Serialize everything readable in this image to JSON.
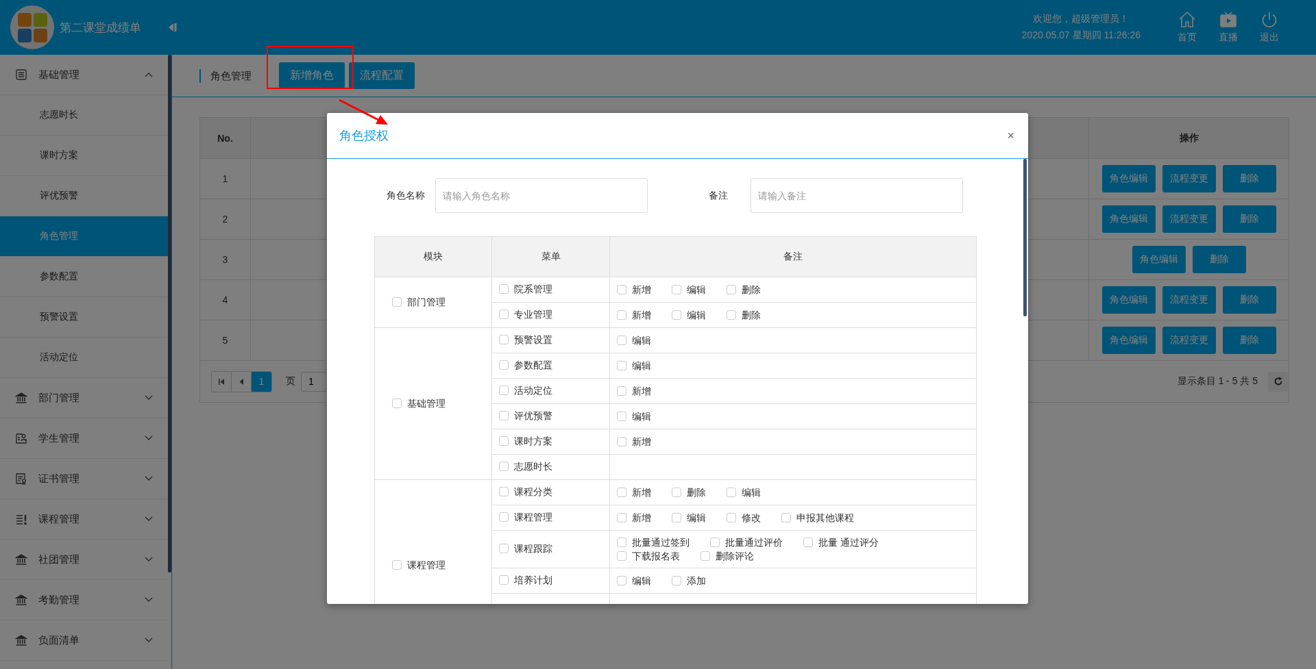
{
  "header": {
    "title": "第二课堂成绩单",
    "welcome": "欢迎您，超级管理员！",
    "datetime": "2020.05.07 星期四 11:26:26",
    "nav": [
      {
        "label": "首页"
      },
      {
        "label": "直播"
      },
      {
        "label": "退出"
      }
    ]
  },
  "sidebar": {
    "groups": [
      {
        "label": "基础管理",
        "expanded": true,
        "children": [
          {
            "label": "志愿时长",
            "selected": false
          },
          {
            "label": "课时方案",
            "selected": false
          },
          {
            "label": "评优预警",
            "selected": false
          },
          {
            "label": "角色管理",
            "selected": true
          },
          {
            "label": "参数配置",
            "selected": false
          },
          {
            "label": "预警设置",
            "selected": false
          },
          {
            "label": "活动定位",
            "selected": false
          }
        ]
      },
      {
        "label": "部门管理",
        "expanded": false
      },
      {
        "label": "学生管理",
        "expanded": false
      },
      {
        "label": "证书管理",
        "expanded": false
      },
      {
        "label": "课程管理",
        "expanded": false
      },
      {
        "label": "社团管理",
        "expanded": false
      },
      {
        "label": "考勤管理",
        "expanded": false
      },
      {
        "label": "负面清单",
        "expanded": false
      }
    ]
  },
  "toolbar": {
    "breadcrumb": "角色管理",
    "buttons": [
      "新增角色",
      "流程配置"
    ]
  },
  "table": {
    "columns": [
      "No.",
      "操作"
    ],
    "rows": [
      {
        "no": "1",
        "actions": [
          "角色编辑",
          "流程变更",
          "删除"
        ]
      },
      {
        "no": "2",
        "actions": [
          "角色编辑",
          "流程变更",
          "删除"
        ]
      },
      {
        "no": "3",
        "actions": [
          "角色编辑",
          "删除"
        ]
      },
      {
        "no": "4",
        "actions": [
          "角色编辑",
          "流程变更",
          "删除"
        ]
      },
      {
        "no": "5",
        "actions": [
          "角色编辑",
          "流程变更",
          "删除"
        ]
      }
    ],
    "pagination": {
      "current": "1",
      "page_label": "页",
      "page_input": "1",
      "summary": "显示条目 1 - 5 共 5"
    }
  },
  "dialog": {
    "title": "角色授权",
    "close": "×",
    "fields": [
      {
        "label": "角色名称",
        "placeholder": "请输入角色名称"
      },
      {
        "label": "备注",
        "placeholder": "请输入备注"
      }
    ],
    "columns": [
      "模块",
      "菜单",
      "备注"
    ],
    "modules": [
      {
        "name": "部门管理",
        "checked": false,
        "menus": [
          {
            "name": "院系管理",
            "checked": false,
            "actions": [
              {
                "label": "新增",
                "checked": false
              },
              {
                "label": "编辑",
                "checked": false
              },
              {
                "label": "删除",
                "checked": false
              }
            ]
          },
          {
            "name": "专业管理",
            "checked": false,
            "actions": [
              {
                "label": "新增",
                "checked": false
              },
              {
                "label": "编辑",
                "checked": false
              },
              {
                "label": "删除",
                "checked": false
              }
            ]
          }
        ]
      },
      {
        "name": "基础管理",
        "checked": false,
        "menus": [
          {
            "name": "预警设置",
            "checked": false,
            "actions": [
              {
                "label": "编辑",
                "checked": false
              }
            ]
          },
          {
            "name": "参数配置",
            "checked": false,
            "actions": [
              {
                "label": "编辑",
                "checked": false
              }
            ]
          },
          {
            "name": "活动定位",
            "checked": false,
            "actions": [
              {
                "label": "新增",
                "checked": false
              }
            ]
          },
          {
            "name": "评优预警",
            "checked": false,
            "actions": [
              {
                "label": "编辑",
                "checked": false
              }
            ]
          },
          {
            "name": "课时方案",
            "checked": false,
            "actions": [
              {
                "label": "新增",
                "checked": false
              }
            ]
          },
          {
            "name": "志愿时长",
            "checked": false
          }
        ]
      },
      {
        "name": "课程管理",
        "checked": false,
        "menus": [
          {
            "name": "课程分类",
            "checked": false,
            "actions": [
              {
                "label": "新增",
                "checked": false
              },
              {
                "label": "删除",
                "checked": false
              },
              {
                "label": "编辑",
                "checked": false
              }
            ]
          },
          {
            "name": "课程管理",
            "checked": false,
            "actions": [
              {
                "label": "新增",
                "checked": false
              },
              {
                "label": "编辑",
                "checked": false
              },
              {
                "label": "修改",
                "checked": false
              },
              {
                "label": "申报其他课程",
                "checked": false
              }
            ]
          },
          {
            "name": "课程跟踪",
            "checked": false,
            "actions": [
              {
                "label": "批量通过签到",
                "checked": false
              },
              {
                "label": "批量通过评价",
                "checked": false
              },
              {
                "label": "批量 通过评分",
                "checked": false
              },
              {
                "label": "下载报名表",
                "checked": false
              },
              {
                "label": "删除评论",
                "checked": false
              }
            ]
          },
          {
            "name": "培养计划",
            "checked": false,
            "actions": [
              {
                "label": "编辑",
                "checked": false
              },
              {
                "label": "添加",
                "checked": false
              }
            ]
          }
        ]
      }
    ]
  }
}
